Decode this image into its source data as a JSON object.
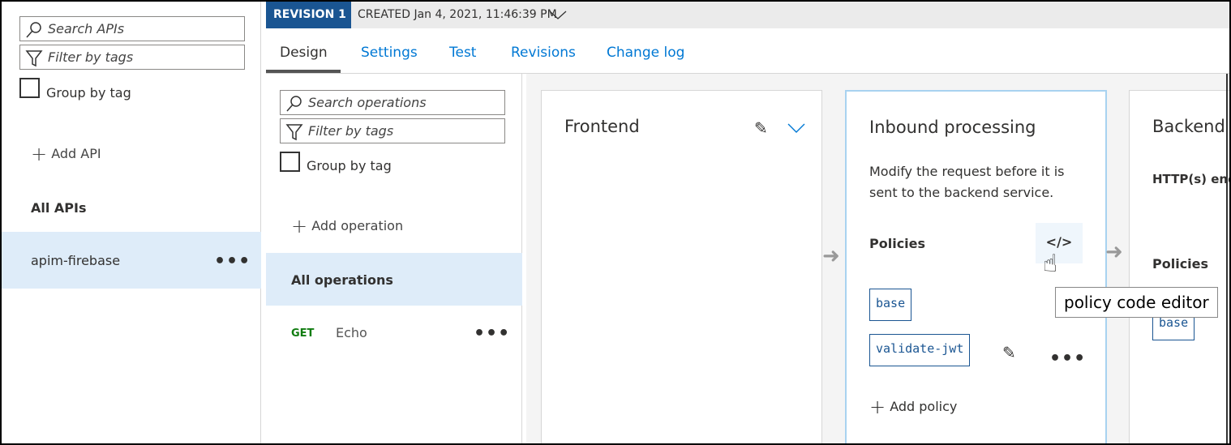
{
  "left": {
    "search_placeholder": "Search APIs",
    "filter_placeholder": "Filter by tags",
    "group_by_tag": "Group by tag",
    "add_api": "Add API",
    "all_apis": "All APIs",
    "apis": [
      {
        "name": "apim-firebase"
      }
    ]
  },
  "header": {
    "revision": "REVISION 1",
    "created": "CREATED Jan 4, 2021, 11:46:39 PM"
  },
  "tabs": [
    {
      "label": "Design"
    },
    {
      "label": "Settings"
    },
    {
      "label": "Test"
    },
    {
      "label": "Revisions"
    },
    {
      "label": "Change log"
    }
  ],
  "operations": {
    "search_placeholder": "Search operations",
    "filter_placeholder": "Filter by tags",
    "group_by_tag": "Group by tag",
    "add_operation": "Add operation",
    "all_operations": "All operations",
    "items": [
      {
        "method": "GET",
        "name": "Echo"
      }
    ]
  },
  "frontend": {
    "title": "Frontend"
  },
  "inbound": {
    "title": "Inbound processing",
    "description": "Modify the request before it is sent to the backend service.",
    "policies_label": "Policies",
    "policies": [
      "base",
      "validate-jwt"
    ],
    "add_policy": "Add policy",
    "tooltip": "policy code editor"
  },
  "backend": {
    "title": "Backend",
    "endpoint": "HTTP(s) end",
    "policies_label": "Policies",
    "policies": [
      "base"
    ]
  },
  "colors": {
    "accent": "#0078d4",
    "revision_bg": "#1a5592",
    "selected": "#deecf9",
    "get": "#107c10"
  }
}
